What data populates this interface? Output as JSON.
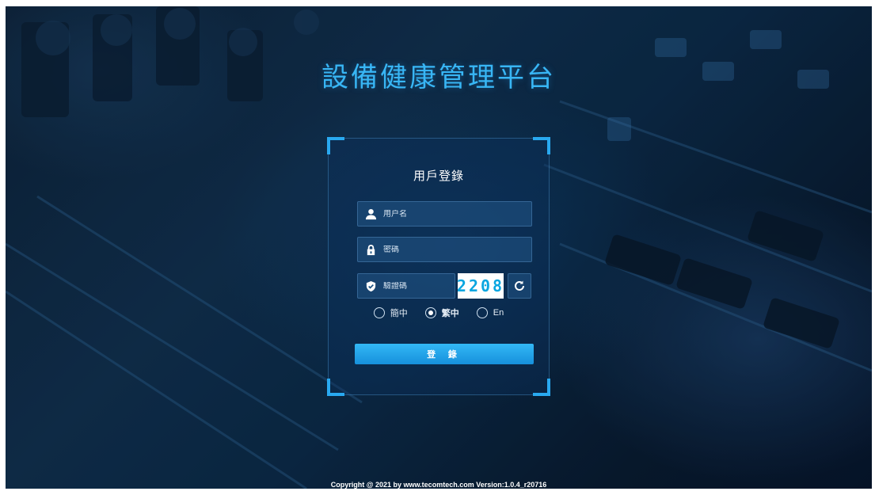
{
  "app": {
    "title": "設備健康管理平台"
  },
  "login": {
    "title": "用戶登錄",
    "username_placeholder": "用户名",
    "password_placeholder": "密碼",
    "captcha_placeholder": "驗證碼",
    "captcha_code": "2208",
    "languages": [
      {
        "label": "簡中",
        "selected": false
      },
      {
        "label": "繁中",
        "selected": true
      },
      {
        "label": "En",
        "selected": false
      }
    ],
    "submit_label": "登 錄"
  },
  "icons": {
    "user": "user-icon",
    "password": "lock-icon",
    "captcha": "shield-check-icon",
    "refresh": "refresh-icon"
  },
  "colors": {
    "accent": "#29a9f0",
    "title": "#38b6f5",
    "button_top": "#33b8f6",
    "button_bottom": "#1690dc"
  },
  "footer": {
    "copyright": "Copyright @ 2021 by www.tecomtech.com Version:1.0.4_r20716"
  }
}
